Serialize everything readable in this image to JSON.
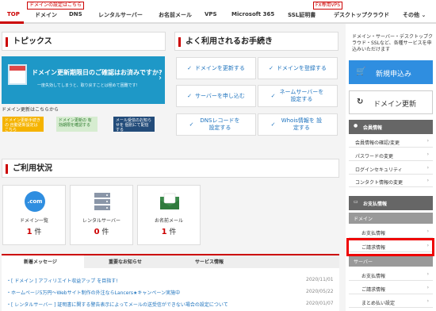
{
  "nav": {
    "promo_domain": "ドメインの設定はこちら",
    "promo_vps": "FX専用VPS",
    "items": [
      "TOP",
      "ドメイン",
      "DNS",
      "レンタルサーバー",
      "お名前メール",
      "VPS",
      "Microsoft 365",
      "SSL証明書",
      "デスクトップクラウド",
      "その他"
    ]
  },
  "topics": {
    "title": "トピックス",
    "banner_title": "ドメイン更新期限日のご確認はお済みですか?",
    "banner_sub": "一度失効してしまうと、取り戻すことは極めて困難です!",
    "renew_label": "ドメイン更新はこちらから",
    "mini_banners": [
      "ドメイン更新手続きの 自動更新設定はこちら",
      "ドメイン更新の 有効期限を確認する",
      "メール受信のお知らせを 個別にて配信する"
    ]
  },
  "procedures": {
    "title": "よく利用されるお手続き",
    "items": [
      "ドメインを更新する",
      "ドメインを登録する",
      "サーバーを申し込む",
      "ネームサーバーを 設定する",
      "DNSレコードを 設定する",
      "Whois情報を 設定する"
    ]
  },
  "usage": {
    "title": "ご利用状況",
    "items": [
      {
        "label": "ドメイン一覧",
        "count": "1",
        "unit": "件",
        "icon": "dotcom-icon"
      },
      {
        "label": "レンタルサーバー",
        "count": "0",
        "unit": "件",
        "icon": "server-icon"
      },
      {
        "label": "お名前メール",
        "count": "1",
        "unit": "件",
        "icon": "mail-icon"
      }
    ],
    "dotcom_text": ".com"
  },
  "tabs": [
    "新着メッセージ",
    "重要なお知らせ",
    "サービス情報"
  ],
  "news": [
    {
      "text": "[ ドメイン ] アフィリエイト収益アップ を目指す!",
      "date": "2020/11/01"
    },
    {
      "text": "ホームページ5万円〜Webサイト制作の外注ならLancers★キャンペーン実施中",
      "date": "2020/05/22"
    },
    {
      "text": "[ レンタルサーバー ] 証明書に関する警告表示によってメールの送受信ができない場合の設定について",
      "date": "2020/01/07"
    }
  ],
  "sidebar": {
    "intro": "ドメイン・サーバー・デスクトップクラウド・SSLなど、各種サービスを申込みいただけます",
    "apply_label": "新規申込み",
    "renew_label": "ドメイン更新",
    "member_head": "会員情報",
    "member_items": [
      "会員情報の確認/変更",
      "パスワードの変更",
      "ログインセキュリティ",
      "コンタクト情報の変更"
    ],
    "payment_head": "お支払情報",
    "sub_domain": "ドメイン",
    "domain_items": [
      "お支払情報",
      "ご請求情報"
    ],
    "sub_server": "サーバー",
    "server_items": [
      "お支払情報",
      "ご請求情報",
      "まとめ払い設定"
    ]
  },
  "colors": {
    "accent": "#cc0000",
    "link": "#1e73be",
    "apply": "#2f8ee0",
    "banner": "#1e98c7"
  }
}
